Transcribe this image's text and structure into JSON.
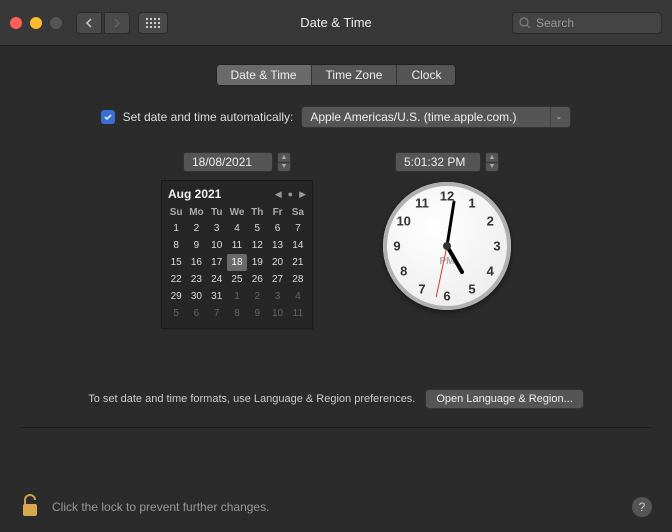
{
  "window": {
    "title": "Date & Time"
  },
  "search": {
    "placeholder": "Search"
  },
  "tabs": {
    "datetime": "Date & Time",
    "timezone": "Time Zone",
    "clock": "Clock"
  },
  "auto": {
    "label": "Set date and time automatically:",
    "server": "Apple Americas/U.S. (time.apple.com.)",
    "checked": true
  },
  "date_input": "18/08/2021",
  "time_input": "5:01:32 PM",
  "calendar": {
    "title": "Aug 2021",
    "dow": [
      "Su",
      "Mo",
      "Tu",
      "We",
      "Th",
      "Fr",
      "Sa"
    ],
    "days": [
      {
        "n": "1"
      },
      {
        "n": "2"
      },
      {
        "n": "3"
      },
      {
        "n": "4"
      },
      {
        "n": "5"
      },
      {
        "n": "6"
      },
      {
        "n": "7"
      },
      {
        "n": "8"
      },
      {
        "n": "9"
      },
      {
        "n": "10"
      },
      {
        "n": "11"
      },
      {
        "n": "12"
      },
      {
        "n": "13"
      },
      {
        "n": "14"
      },
      {
        "n": "15"
      },
      {
        "n": "16"
      },
      {
        "n": "17"
      },
      {
        "n": "18",
        "sel": true
      },
      {
        "n": "19"
      },
      {
        "n": "20"
      },
      {
        "n": "21"
      },
      {
        "n": "22"
      },
      {
        "n": "23"
      },
      {
        "n": "24"
      },
      {
        "n": "25"
      },
      {
        "n": "26"
      },
      {
        "n": "27"
      },
      {
        "n": "28"
      },
      {
        "n": "29"
      },
      {
        "n": "30"
      },
      {
        "n": "31"
      },
      {
        "n": "1",
        "other": true
      },
      {
        "n": "2",
        "other": true
      },
      {
        "n": "3",
        "other": true
      },
      {
        "n": "4",
        "other": true
      },
      {
        "n": "5",
        "other": true
      },
      {
        "n": "6",
        "other": true
      },
      {
        "n": "7",
        "other": true
      },
      {
        "n": "8",
        "other": true
      },
      {
        "n": "9",
        "other": true
      },
      {
        "n": "10",
        "other": true
      },
      {
        "n": "11",
        "other": true
      }
    ]
  },
  "clock": {
    "numbers": [
      "12",
      "1",
      "2",
      "3",
      "4",
      "5",
      "6",
      "7",
      "8",
      "9",
      "10",
      "11"
    ],
    "ampm": "PM",
    "hour_angle": 150,
    "minute_angle": 9,
    "second_angle": 192
  },
  "hint": {
    "text": "To set date and time formats, use Language & Region preferences.",
    "button": "Open Language & Region..."
  },
  "footer": {
    "lock_text": "Click the lock to prevent further changes."
  }
}
